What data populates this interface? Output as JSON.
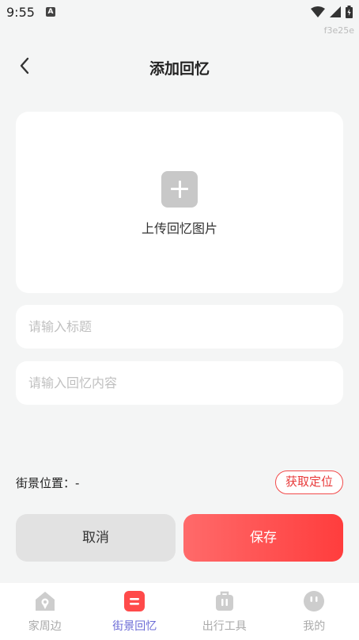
{
  "status_bar": {
    "time": "9:55",
    "notification_icon": "A",
    "build_tag": "f3e25e"
  },
  "header": {
    "title": "添加回忆",
    "back_icon": "chevron-left-icon"
  },
  "upload": {
    "label": "上传回忆图片",
    "icon": "plus-icon"
  },
  "form": {
    "title_placeholder": "请输入标题",
    "content_placeholder": "请输入回忆内容"
  },
  "location": {
    "label": "街景位置：-",
    "get_location_button": "获取定位"
  },
  "actions": {
    "cancel_label": "取消",
    "save_label": "保存"
  },
  "tabs": [
    {
      "label": "家周边",
      "icon": "home-location-icon",
      "active": false
    },
    {
      "label": "街景回忆",
      "icon": "memory-icon",
      "active": true
    },
    {
      "label": "出行工具",
      "icon": "luggage-icon",
      "active": false
    },
    {
      "label": "我的",
      "icon": "profile-face-icon",
      "active": false
    }
  ],
  "colors": {
    "accent": "#ff4a4a",
    "active_tab": "#6b6bd6",
    "inactive_tab": "#c8c8c8",
    "background": "#f4f5f5"
  }
}
